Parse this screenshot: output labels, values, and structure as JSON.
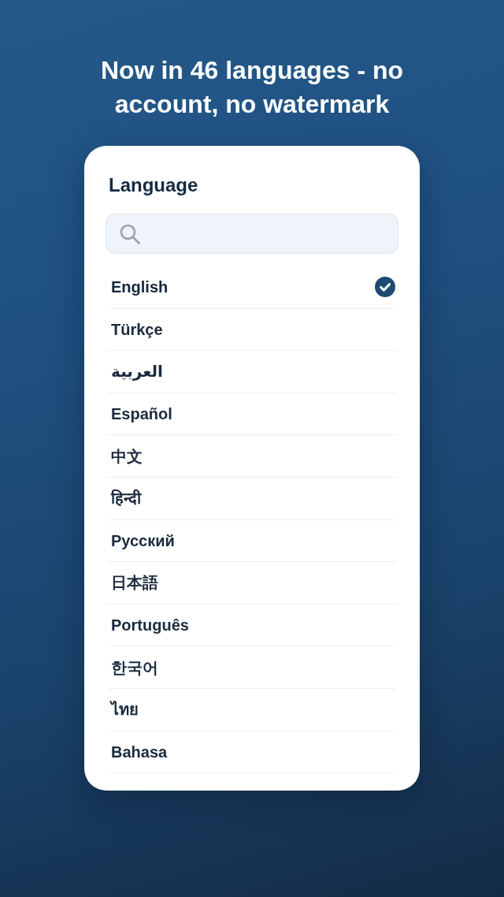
{
  "headline": "Now in 46 languages - no account, no watermark",
  "panel": {
    "title": "Language",
    "languages": [
      {
        "name": "English",
        "selected": true
      },
      {
        "name": "Türkçe",
        "selected": false
      },
      {
        "name": "العربية",
        "selected": false
      },
      {
        "name": "Español",
        "selected": false
      },
      {
        "name": "中文",
        "selected": false
      },
      {
        "name": "हिन्दी",
        "selected": false
      },
      {
        "name": "Русский",
        "selected": false
      },
      {
        "name": "日本語",
        "selected": false
      },
      {
        "name": "Português",
        "selected": false
      },
      {
        "name": "한국어",
        "selected": false
      },
      {
        "name": "ไทย",
        "selected": false
      },
      {
        "name": "Bahasa",
        "selected": false
      }
    ]
  }
}
